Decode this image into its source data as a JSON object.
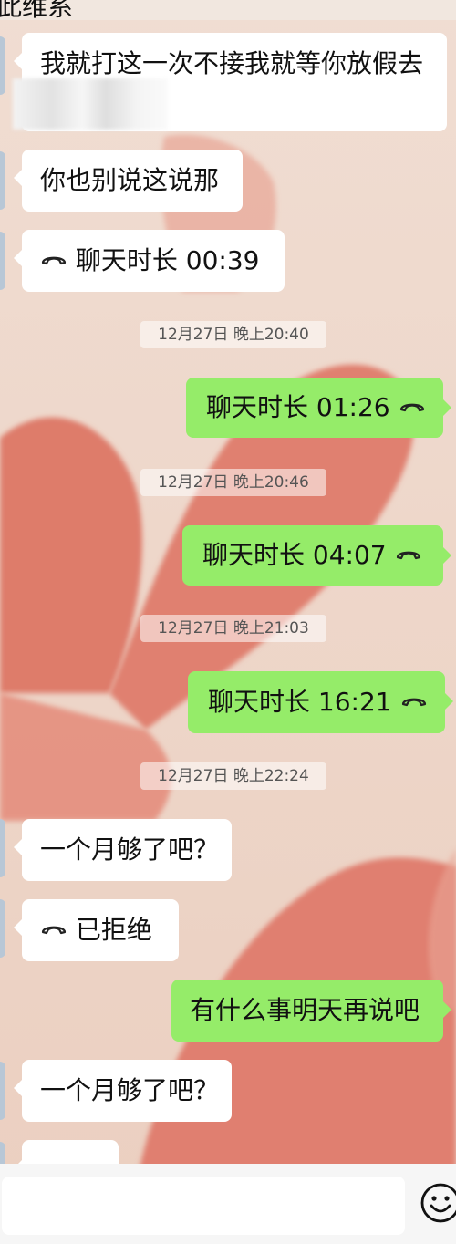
{
  "header": {
    "title_partial": "此维系"
  },
  "messages": [
    {
      "side": "left",
      "type": "text",
      "text": "我就打这一次不接我就等你放假去"
    },
    {
      "side": "left",
      "type": "text",
      "text": "你也别说这说那"
    },
    {
      "side": "left",
      "type": "call",
      "text": "聊天时长 00:39"
    },
    {
      "type": "timestamp",
      "text": "12月27日 晚上20:40"
    },
    {
      "side": "right",
      "type": "call",
      "text": "聊天时长 01:26"
    },
    {
      "type": "timestamp",
      "text": "12月27日 晚上20:46"
    },
    {
      "side": "right",
      "type": "call",
      "text": "聊天时长 04:07"
    },
    {
      "type": "timestamp",
      "text": "12月27日 晚上21:03"
    },
    {
      "side": "right",
      "type": "call",
      "text": "聊天时长 16:21"
    },
    {
      "type": "timestamp",
      "text": "12月27日 晚上22:24"
    },
    {
      "side": "left",
      "type": "text",
      "text": "一个月够了吧？"
    },
    {
      "side": "left",
      "type": "call",
      "text": "已拒绝"
    },
    {
      "side": "right",
      "type": "text",
      "text": "有什么事明天再说吧"
    },
    {
      "side": "left",
      "type": "text",
      "text": "一个月够了吧？"
    },
    {
      "side": "left",
      "type": "text",
      "text": "……"
    }
  ],
  "input": {
    "placeholder": "",
    "emoji_icon": "smile-emoji-icon"
  },
  "colors": {
    "sent_bubble": "#95ec69",
    "received_bubble": "#ffffff",
    "heart": "#e07f70",
    "wallpaper": "#eed6c8"
  }
}
